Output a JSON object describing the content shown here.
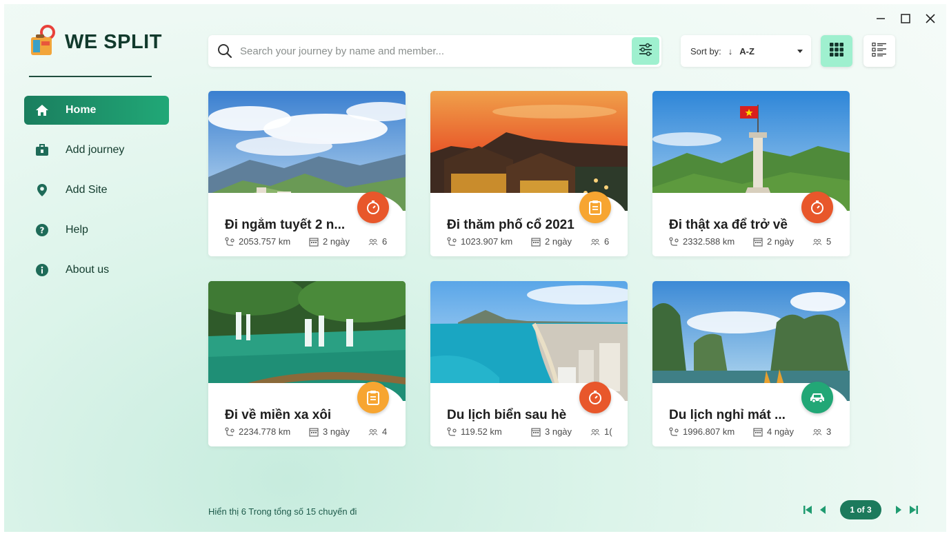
{
  "window_controls": {
    "minimize": "minimize-icon",
    "maximize": "maximize-icon",
    "close": "close-icon"
  },
  "app": {
    "title": "WE SPLIT",
    "logo_icon": "luggage-pin-icon"
  },
  "sidebar": {
    "items": [
      {
        "label": "Home",
        "icon": "home-icon",
        "active": true
      },
      {
        "label": "Add journey",
        "icon": "suitcase-icon",
        "active": false
      },
      {
        "label": "Add Site",
        "icon": "location-pin-icon",
        "active": false
      },
      {
        "label": "Help",
        "icon": "question-icon",
        "active": false
      },
      {
        "label": "About us",
        "icon": "info-icon",
        "active": false
      }
    ]
  },
  "search": {
    "placeholder": "Search your journey by name and member...",
    "value": ""
  },
  "sort": {
    "label": "Sort by:",
    "direction": "↓",
    "value": "A-Z"
  },
  "colors": {
    "accent": "#1f9b70",
    "accent_light": "#9ff0cf",
    "badge_orange": "#e8572b",
    "badge_yellow": "#f7a531",
    "badge_green": "#22a776"
  },
  "cards": [
    {
      "title": "Đi ngắm tuyết 2 n...",
      "distance": "2053.757 km",
      "days": "2 ngày",
      "members": "6",
      "badge": "stopwatch-icon",
      "badge_color": "#e8572b"
    },
    {
      "title": "Đi thăm phố cổ 2021",
      "distance": "1023.907 km",
      "days": "2 ngày",
      "members": "6",
      "badge": "checklist-icon",
      "badge_color": "#f7a531"
    },
    {
      "title": "Đi thật xa để trở về",
      "distance": "2332.588 km",
      "days": "2 ngày",
      "members": "5",
      "badge": "stopwatch-icon",
      "badge_color": "#e8572b"
    },
    {
      "title": "Đi về miền xa xôi",
      "distance": "2234.778 km",
      "days": "3 ngày",
      "members": "4",
      "badge": "checklist-icon",
      "badge_color": "#f7a531"
    },
    {
      "title": "Du lịch biển sau hè",
      "distance": "119.52 km",
      "days": "3 ngày",
      "members": "1(",
      "badge": "stopwatch-icon",
      "badge_color": "#e8572b"
    },
    {
      "title": "Du lịch nghỉ mát ...",
      "distance": "1996.807 km",
      "days": "4 ngày",
      "members": "3",
      "badge": "car-icon",
      "badge_color": "#22a776"
    }
  ],
  "footer": {
    "summary": "Hiển thị 6 Trong tổng số 15 chuyến đi"
  },
  "pagination": {
    "label": "1 of 3"
  }
}
